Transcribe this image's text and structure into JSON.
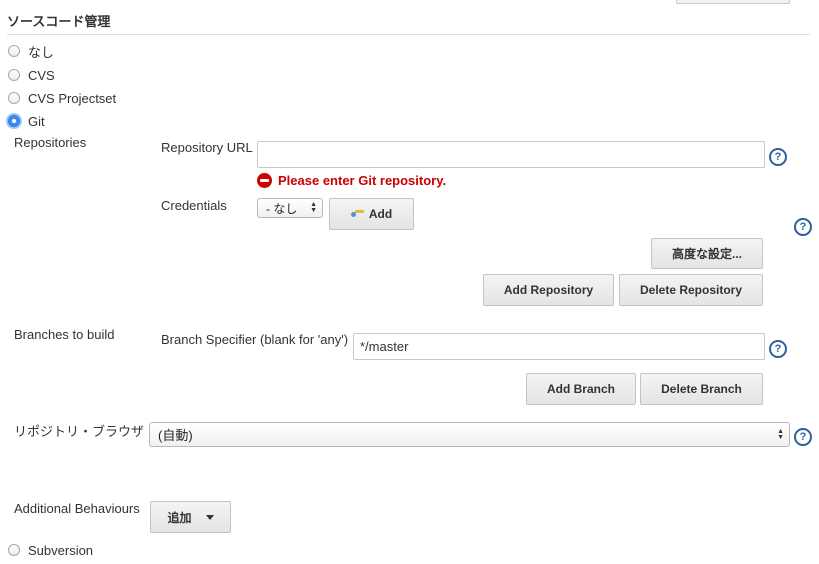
{
  "section": {
    "title": "ソースコード管理"
  },
  "scm_options": [
    {
      "label": "なし",
      "selected": false
    },
    {
      "label": "CVS",
      "selected": false
    },
    {
      "label": "CVS Projectset",
      "selected": false
    },
    {
      "label": "Git",
      "selected": true
    }
  ],
  "repositories": {
    "label": "Repositories",
    "url_label": "Repository URL",
    "url_value": "",
    "error": "Please enter Git repository.",
    "credentials_label": "Credentials",
    "credentials_value": "- なし",
    "add_label": "Add",
    "advanced_label": "高度な設定...",
    "add_repository": "Add Repository",
    "delete_repository": "Delete Repository"
  },
  "branches": {
    "label": "Branches to build",
    "specifier_label": "Branch Specifier (blank for 'any')",
    "specifier_value": "*/master",
    "add_branch": "Add Branch",
    "delete_branch": "Delete Branch"
  },
  "browser": {
    "label": "リポジトリ・ブラウザ",
    "value": "(自動)"
  },
  "behaviours": {
    "label": "Additional Behaviours",
    "add_label": "追加"
  },
  "subversion": {
    "label": "Subversion",
    "selected": false
  },
  "help_glyph": "?",
  "colors": {
    "error": "#cc0000",
    "help_blue": "#2e5f9e",
    "radio_selected": "#3b8df2"
  },
  "icons": [
    "radio-icon",
    "error-icon",
    "key-icon",
    "help-icon",
    "chevron-down-icon",
    "updown-arrows-icon"
  ]
}
